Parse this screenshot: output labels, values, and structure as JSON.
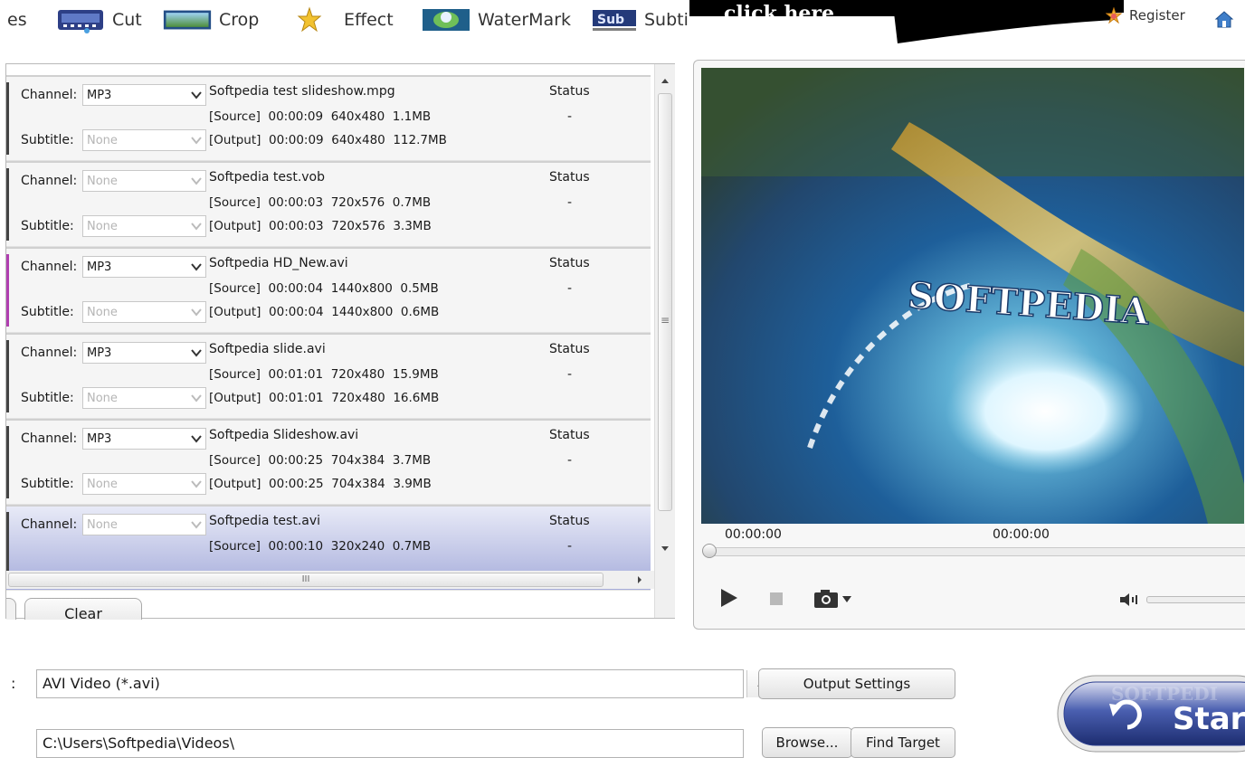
{
  "toolbar": {
    "partial_left": "es",
    "cut": "Cut",
    "crop": "Crop",
    "effect": "Effect",
    "watermark": "WaterMark",
    "subtitle": "Subti",
    "banner_text": "click here",
    "register": "Register"
  },
  "file_list": {
    "channel_label": "Channel:",
    "subtitle_label": "Subtitle:",
    "status_label": "Status",
    "status_value": "-",
    "rows": [
      {
        "channel": "MP3",
        "subtitle": "None",
        "name": "Softpedia test slideshow.mpg",
        "source": "[Source]  00:00:09  640x480  1.1MB",
        "output": "[Output]  00:00:09  640x480  112.7MB"
      },
      {
        "channel": "None",
        "subtitle": "None",
        "name": "Softpedia test.vob",
        "source": "[Source]  00:00:03  720x576  0.7MB",
        "output": "[Output]  00:00:03  720x576  3.3MB"
      },
      {
        "channel": "MP3",
        "subtitle": "None",
        "name": "Softpedia HD_New.avi",
        "source": "[Source]  00:00:04  1440x800  0.5MB",
        "output": "[Output]  00:00:04  1440x800  0.6MB"
      },
      {
        "channel": "MP3",
        "subtitle": "None",
        "name": "Softpedia slide.avi",
        "source": "[Source]  00:01:01  720x480  15.9MB",
        "output": "[Output]  00:01:01  720x480  16.6MB"
      },
      {
        "channel": "MP3",
        "subtitle": "None",
        "name": "Softpedia Slideshow.avi",
        "source": "[Source]  00:00:25  704x384  3.7MB",
        "output": "[Output]  00:00:25  704x384  3.9MB"
      },
      {
        "channel": "None",
        "subtitle": "",
        "name": "Softpedia test.avi",
        "source": "[Source]  00:00:10  320x240  0.7MB",
        "output": ""
      }
    ],
    "clear_button": "Clear",
    "hscroll_grip": "III",
    "vscroll_grip": "≡"
  },
  "preview": {
    "watermark": "SOFTPEDIA",
    "time_current": "00:00:00",
    "time_total": "00:00:00",
    "seek_position": 0
  },
  "output": {
    "label_colon": ":",
    "format_value": "AVI Video (*.avi)",
    "path_value": "C:\\Users\\Softpedia\\Videos\\",
    "output_settings": "Output Settings",
    "browse": "Browse...",
    "find_target": "Find Target",
    "start": "Star",
    "start_watermark": "SOFTPEDI"
  },
  "colors": {
    "selected_row_top": "#e8eaf7",
    "selected_row_bottom": "#a6addb",
    "start_button": "#2c3f8f"
  }
}
